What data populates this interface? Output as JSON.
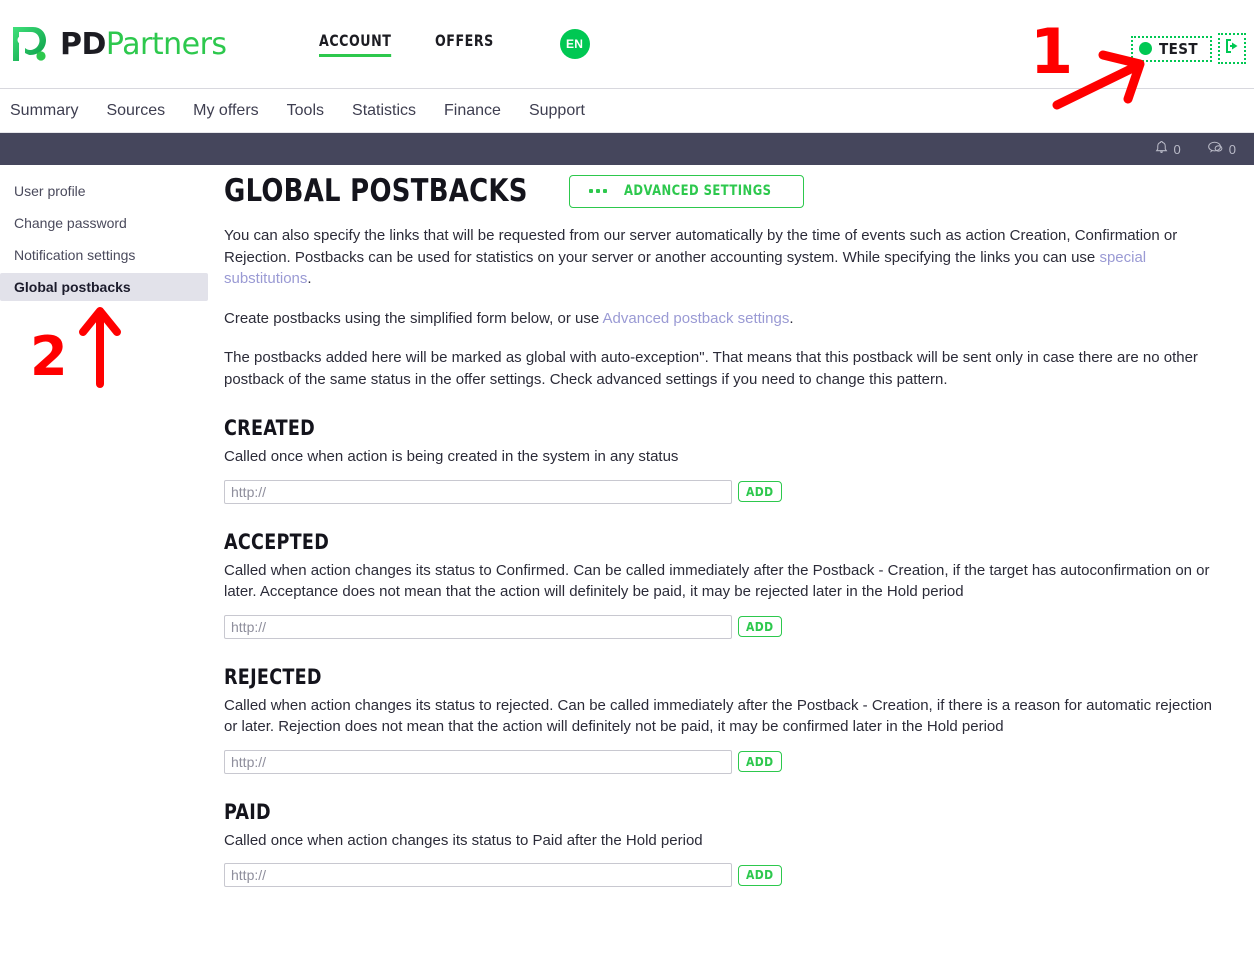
{
  "brand": {
    "logo_icon": "pd-droplet-logo-icon",
    "name_bold": "PD",
    "name_light": "Partners",
    "accent_green": "#2dc84d",
    "dark_text": "#1c1c22"
  },
  "header": {
    "tabs": [
      {
        "label": "ACCOUNT",
        "active": true
      },
      {
        "label": "OFFERS",
        "active": false
      }
    ],
    "language": {
      "label": "EN",
      "icon": "globe-language-icon"
    },
    "account_status": {
      "label": "TEST",
      "dot_color": "#00c853",
      "dot_icon": "status-dot-icon"
    },
    "logout": {
      "icon": "logout-arrow-icon",
      "color": "#00c853"
    }
  },
  "mainnav": {
    "items": [
      "Summary",
      "Sources",
      "My offers",
      "Tools",
      "Statistics",
      "Finance",
      "Support"
    ]
  },
  "darkbar": {
    "bg": "#45465c",
    "notifications": {
      "icon": "bell-icon",
      "count": "0"
    },
    "messages": {
      "icon": "chat-bubble-icon",
      "count": "0"
    }
  },
  "sidebar": {
    "items": [
      {
        "label": "User profile",
        "active": false
      },
      {
        "label": "Change password",
        "active": false
      },
      {
        "label": "Notification settings",
        "active": false
      },
      {
        "label": "Global postbacks",
        "active": true
      }
    ]
  },
  "main": {
    "title": "GLOBAL POSTBACKS",
    "advanced_button": {
      "label": "ADVANCED SETTINGS",
      "icon": "three-dots-icon"
    },
    "paragraphs": {
      "p1_a": "You can also specify the links that will be requested from our server automatically by the time of events such as action Creation, Confirmation or Rejection. Postbacks can be used for statistics on your server or another accounting system. While specifying the links you can use ",
      "p1_link": "special substitutions",
      "p1_b": ".",
      "p2_a": "Create postbacks using the simplified form below, or use ",
      "p2_link": "Advanced postback settings",
      "p2_b": ".",
      "p3": "The postbacks added here will be marked as global with auto-exception\". That means that this postback will be sent only in case there are no other postback of the same status in the offer settings. Check advanced settings if you need to change this pattern."
    },
    "sections": [
      {
        "title": "CREATED",
        "description": "Called once when action is being created in the system in any status",
        "input_value": "",
        "input_placeholder": "http://",
        "add_label": "ADD"
      },
      {
        "title": "ACCEPTED",
        "description": "Called when action changes its status to Confirmed. Can be called immediately after the Postback - Creation, if the target has autoconfirmation on or later. Acceptance does not mean that the action will definitely be paid, it may be rejected later in the Hold period",
        "input_value": "",
        "input_placeholder": "http://",
        "add_label": "ADD"
      },
      {
        "title": "REJECTED",
        "description": "Called when action changes its status to rejected. Can be called immediately after the Postback - Creation, if there is a reason for automatic rejection or later. Rejection does not mean that the action will definitely not be paid, it may be confirmed later in the Hold period",
        "input_value": "",
        "input_placeholder": "http://",
        "add_label": "ADD"
      },
      {
        "title": "PAID",
        "description": "Called once when action changes its status to Paid after the Hold period",
        "input_value": "",
        "input_placeholder": "http://",
        "add_label": "ADD"
      }
    ]
  },
  "annotations": {
    "color": "#ff0000",
    "markers": [
      {
        "number": "1",
        "icon": "red-arrow-right-icon"
      },
      {
        "number": "2",
        "icon": "red-arrow-up-icon"
      }
    ]
  }
}
